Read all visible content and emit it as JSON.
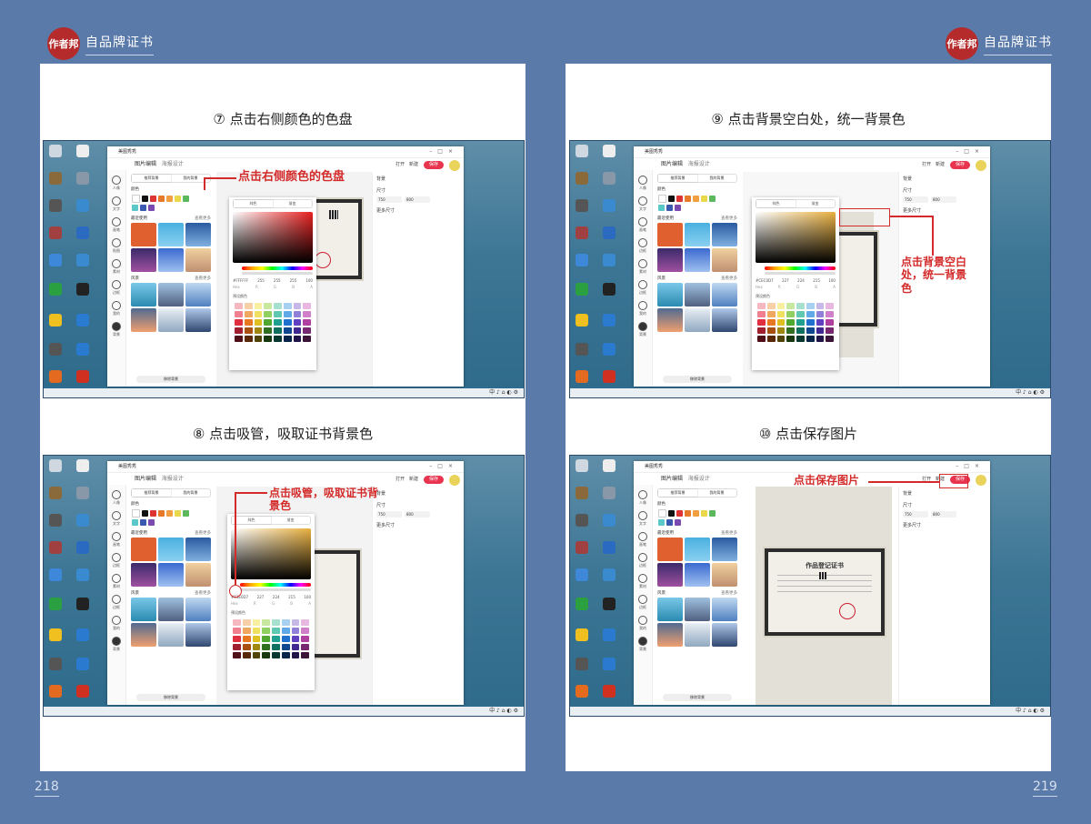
{
  "header": {
    "logo": "作者邦",
    "title": "自品牌证书"
  },
  "pages": [
    {
      "number": "218"
    },
    {
      "number": "219"
    }
  ],
  "steps": [
    {
      "caption": "⑦ 点击右侧颜色的色盘",
      "annotation": "点击右侧颜色的色盘"
    },
    {
      "caption": "⑧ 点击吸管，吸取证书背景色",
      "annotation": "点击吸管，吸取证书背景色"
    },
    {
      "caption": "⑨ 点击背景空白处，统一背景色",
      "annotation": "点击背景空白处，统一背景色"
    },
    {
      "caption": "⑩ 点击保存图片",
      "annotation": "点击保存图片"
    }
  ],
  "app": {
    "name": "美图秀秀",
    "tabs": [
      "图片编辑",
      "海报设计"
    ],
    "open_label": "打开",
    "new_label": "新建",
    "save_label": "保存",
    "rail": [
      "人像",
      "文字",
      "画笔",
      "贴图",
      "边框",
      "素材",
      "边框",
      "我的",
      "背景"
    ],
    "bg_tabs": [
      "推荐背景",
      "我的背景"
    ],
    "color_label": "颜色",
    "recent_label": "最近使用",
    "more_label": "查看更多",
    "scenery_label": "风景",
    "remove_bg": "移除背景",
    "right_title": "背景",
    "size_label": "尺寸",
    "width": "750",
    "height": "800",
    "more_size": "更多尺寸",
    "picker_tabs": [
      "纯色",
      "渐变"
    ],
    "hex_a": "#FFFFFF",
    "hex_b": "#CEC0D7",
    "hex_c": "#E3E0D7",
    "rgba_a": [
      "255",
      "255",
      "255",
      "100"
    ],
    "rgba_b": [
      "227",
      "224",
      "215",
      "100"
    ],
    "rgb_labels": [
      "Hex",
      "R",
      "G",
      "B",
      "A"
    ],
    "preset_label": "预设颜色",
    "cert_title": "作品登记证书"
  },
  "taskbar": "中 ♪ ⌂ ◐ ⚙"
}
